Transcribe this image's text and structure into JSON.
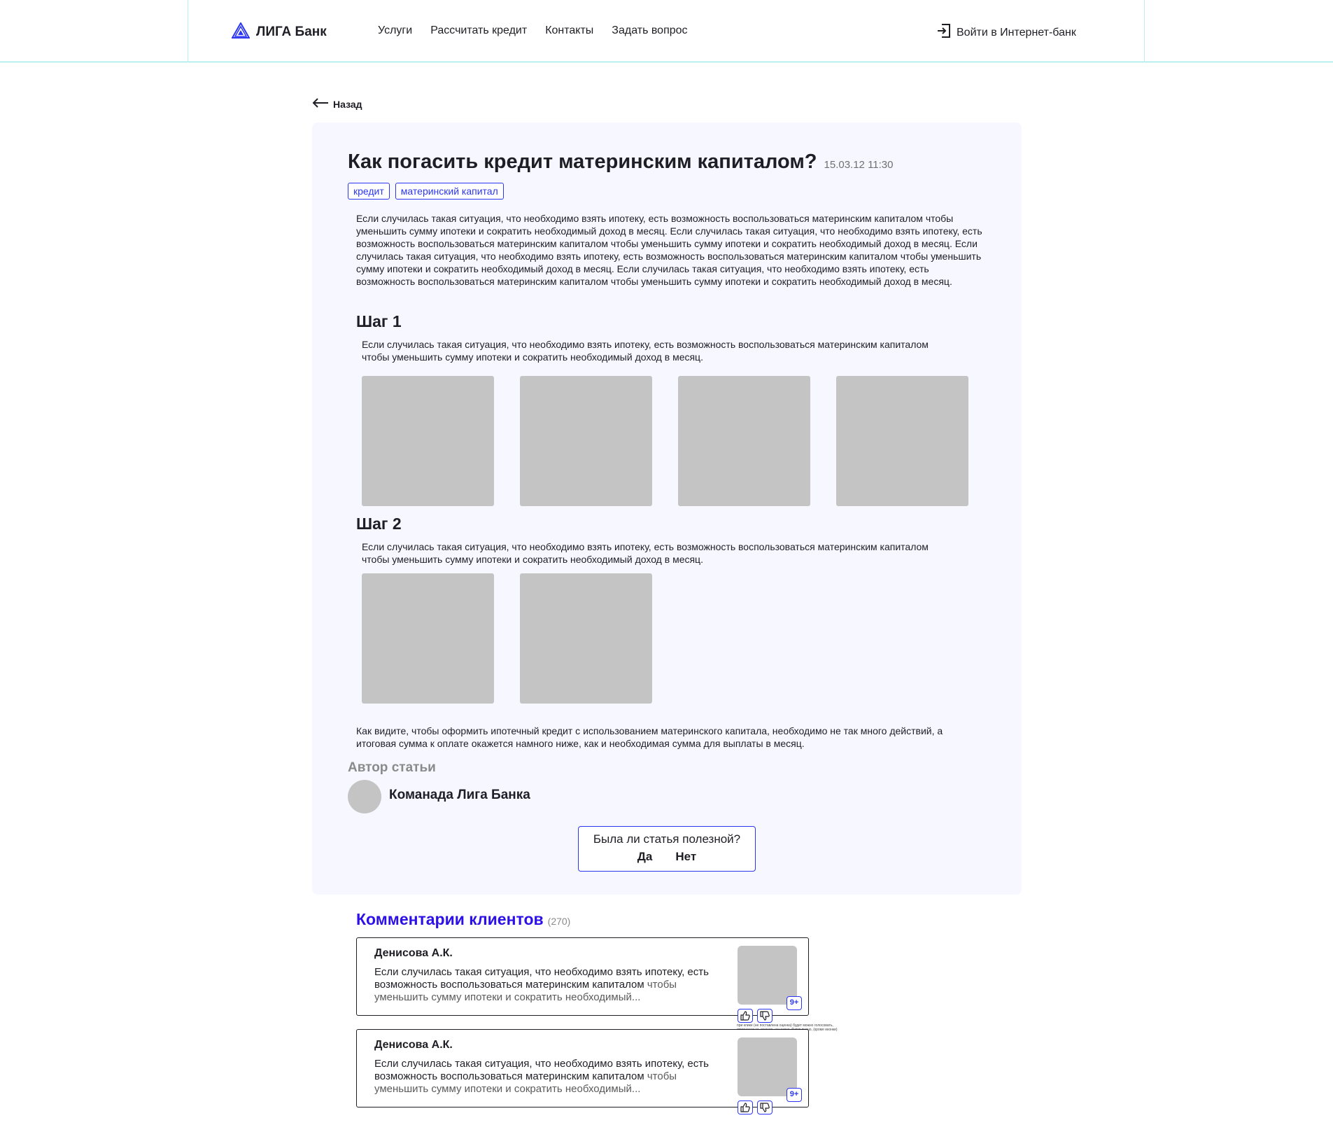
{
  "header": {
    "logo_text": "ЛИГА Банк",
    "nav": [
      "Услуги",
      "Рассчитать кредит",
      "Контакты",
      "Задать вопрос"
    ],
    "login_label": "Войти в Интернет-банк",
    "logo_icon": "triangle-logo-icon",
    "login_icon": "login-door-icon"
  },
  "back_label": "Назад",
  "article": {
    "title": "Как погасить кредит материнским капиталом?",
    "date": "15.03.12 11:30",
    "tags": [
      "кредит",
      "материнский капитал"
    ],
    "intro": "Если случилась такая ситуация, что необходимо взять ипотеку, есть возможность воспользоваться материнским капиталом чтобы уменьшить сумму ипотеки и сократить необходимый доход в месяц.  Если случилась такая ситуация, что необходимо взять ипотеку, есть возможность воспользоваться материнским капиталом чтобы уменьшить сумму ипотеки и сократить необходимый доход в месяц.  Если случилась такая ситуация, что необходимо взять ипотеку, есть возможность воспользоваться материнским капиталом чтобы уменьшить сумму ипотеки и сократить необходимый доход в месяц.  Если случилась такая ситуация, что необходимо взять ипотеку, есть возможность воспользоваться материнским капиталом чтобы уменьшить сумму ипотеки и сократить необходимый доход в месяц.",
    "steps": [
      {
        "title": "Шаг 1",
        "text": "Если случилась такая ситуация, что необходимо взять ипотеку, есть возможность воспользоваться материнским капиталом чтобы уменьшить сумму ипотеки и сократить необходимый доход в месяц.",
        "image_count": 4
      },
      {
        "title": "Шаг 2",
        "text": "Если случилась такая ситуация, что необходимо взять ипотеку, есть возможность воспользоваться материнским капиталом чтобы уменьшить сумму ипотеки и сократить необходимый доход в месяц.",
        "image_count": 2
      }
    ],
    "outro": "Как видите, чтобы оформить ипотечный кредит с использованием материнского капитала, необходимо не так много действий, а итоговая сумма к оплате окажется намного ниже, как и необходимая сумма для выплаты в месяц.",
    "author_label": "Автор статьи",
    "author_name": "Команада Лига Банка",
    "poll": {
      "question": "Была ли статья полезной?",
      "yes": "Да",
      "no": "Нет"
    }
  },
  "comments": {
    "title": "Комментарии клиентов",
    "count": "(270)",
    "items": [
      {
        "author": "Денисова А.К.",
        "text": "Если случилась такая ситуация, что необходимо взять ипотеку, есть возможность воспользоваться материнским капиталом",
        "text_faded": "чтобы уменьшить сумму ипотеки и сократить необходимый...",
        "badge": "9+"
      },
      {
        "author": "Денисова А.К.",
        "text": "Если случилась такая ситуация, что необходимо взять ипотеку, есть возможность воспользоваться материнским капиталом",
        "text_faded": "чтобы уменьшить сумму ипотеки и сократить необходимый...",
        "badge": "9+"
      }
    ],
    "note": "при клике (не поставлена оценка) будет можно голосовать, отмененно за, мнение, не нужна, будет видно, (кроме иконки)"
  },
  "colors": {
    "accent": "#2c36f2",
    "accent_title": "#2c10e8",
    "card_bg": "#f6f7ff",
    "placeholder": "#c4c4c4",
    "header_line": "#7fe3e3"
  }
}
